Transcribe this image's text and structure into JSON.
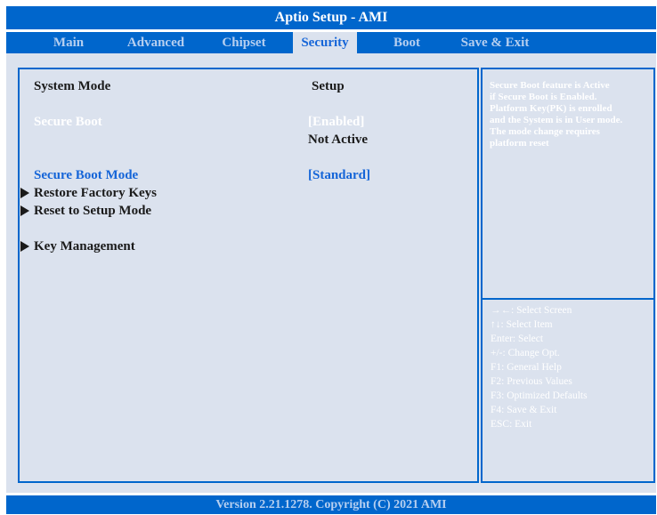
{
  "title": "Aptio Setup - AMI",
  "tabs": [
    {
      "label": "Main"
    },
    {
      "label": "Advanced"
    },
    {
      "label": "Chipset"
    },
    {
      "label": "Security"
    },
    {
      "label": "Boot"
    },
    {
      "label": "Save & Exit"
    }
  ],
  "active_tab": "Security",
  "settings": {
    "system_mode": {
      "label": "System Mode",
      "value": "Setup"
    },
    "secure_boot": {
      "label": "Secure Boot",
      "value": "[Enabled]",
      "status": "Not Active"
    },
    "secure_boot_mode": {
      "label": "Secure Boot Mode",
      "value": "[Standard]"
    },
    "restore_factory_keys": {
      "label": "Restore Factory Keys",
      "icon": "submenu-arrow-icon"
    },
    "reset_to_setup_mode": {
      "label": "Reset to Setup Mode",
      "icon": "submenu-arrow-icon"
    },
    "key_management": {
      "label": "Key Management",
      "icon": "submenu-arrow-icon"
    }
  },
  "help_text": [
    "Secure Boot feature is Active",
    "if Secure Boot is Enabled.",
    "Platform Key(PK) is enrolled",
    "and the System is in User mode.",
    "The mode change requires",
    "platform reset"
  ],
  "key_help": [
    "→←: Select Screen",
    "↑↓: Select Item",
    "Enter: Select",
    "+/-: Change Opt.",
    "F1: General Help",
    "F2: Previous Values",
    "F3: Optimized Defaults",
    "F4: Save & Exit",
    "ESC: Exit"
  ],
  "footer": "Version 2.21.1278. Copyright (C) 2021 AMI",
  "colors": {
    "accent": "#0066cc",
    "background": "#dbe2ee",
    "highlight": "#1565d8",
    "inactive_tab": "#b6cff0"
  }
}
